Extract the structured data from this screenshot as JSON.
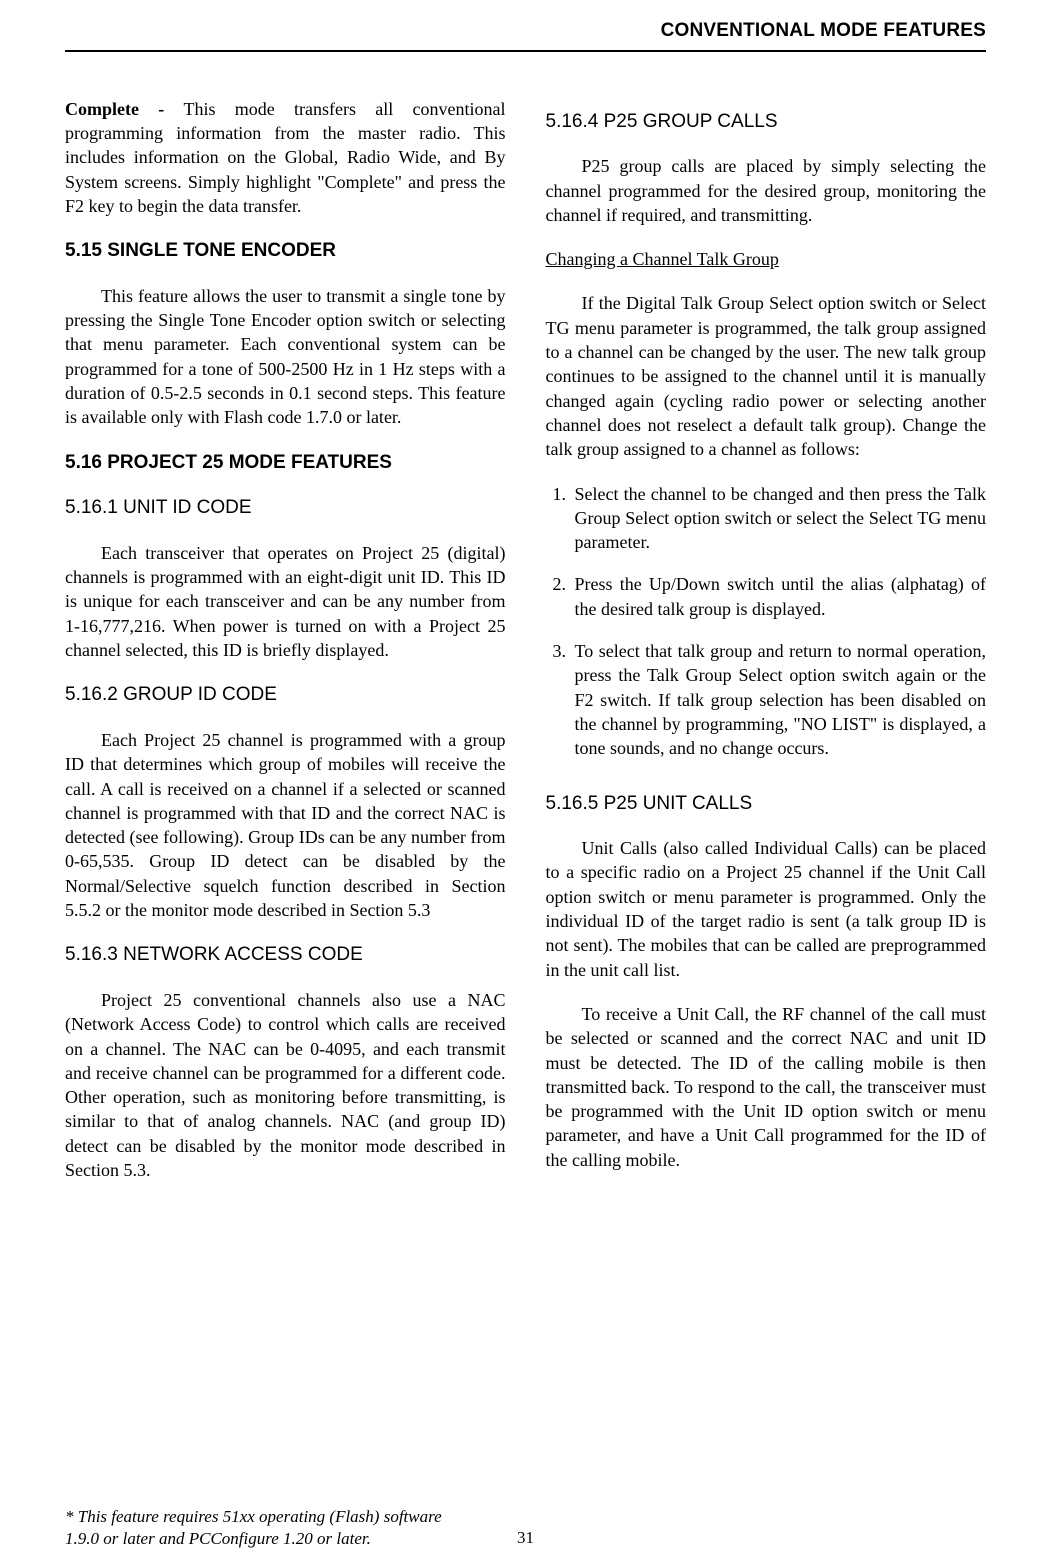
{
  "header": "CONVENTIONAL MODE FEATURES",
  "col1": {
    "p1_bold": "Complete - ",
    "p1_rest": "This mode transfers all conventional programming information from the master radio. This includes information on the Global, Radio Wide, and By System screens. Simply highlight \"Complete\" and press the F2 key to begin the data transfer.",
    "h515": "5.15 SINGLE TONE ENCODER",
    "p515": "This feature allows the user to transmit a single tone by pressing the Single Tone Encoder option switch or selecting that menu parameter. Each conventional system can be programmed for a tone of 500-2500 Hz in 1 Hz steps with a duration of 0.5-2.5 seconds in 0.1 second steps. This feature is available only with Flash code 1.7.0 or later.",
    "h516": "5.16 PROJECT 25 MODE FEATURES",
    "h5161": "5.16.1  UNIT ID CODE",
    "p5161": "Each transceiver that operates on Project 25 (digital) channels is programmed with an eight-digit unit ID. This ID is unique for each transceiver and can be any number from 1-16,777,216. When power is turned on with a Project 25 channel selected, this ID is briefly displayed.",
    "h5162": "5.16.2  GROUP ID CODE",
    "p5162": "Each Project 25 channel is programmed with a group ID that determines which group of mobiles will receive the call. A call is received on a channel if a selected or scanned channel is programmed with that ID and the correct NAC is detected (see following). Group IDs can be any number from 0-65,535. Group ID detect can be disabled by the Normal/Selective squelch function described in Section 5.5.2 or the monitor mode described in Section 5.3",
    "h5163": "5.16.3  NETWORK ACCESS CODE",
    "p5163": "Project 25 conventional channels also use a NAC (Network Access Code) to control which calls are received on a channel. The NAC can be 0-4095, and each transmit and receive channel can be programmed for a different code. Other operation, such as monitoring before transmitting, is similar to that of analog channels. NAC (and group ID) detect can be disabled by the monitor mode described in Section 5.3."
  },
  "col2": {
    "h5164": "5.16.4  P25 GROUP CALLS",
    "p5164": "P25 group calls are placed by simply selecting the channel programmed for the desired group, monitoring the channel if required, and transmitting.",
    "subhead1": "Changing a Channel Talk Group",
    "p_change": "If the Digital Talk Group Select option switch or Select TG menu parameter is programmed, the talk group assigned to a channel can be changed by the user. The new talk group continues to be assigned to the channel until it is manually changed again (cycling radio power or selecting another channel does not reselect a default talk group). Change the talk group assigned to a channel as follows:",
    "list": [
      "Select the channel to be changed and then press the Talk Group Select option switch or select the Select TG menu parameter.",
      "Press the Up/Down switch until the alias (alphatag) of the desired talk group is displayed.",
      "To select that talk group and return to normal operation, press the Talk Group Select option switch again or the F2 switch. If talk group selection has been disabled on the channel by programming, \"NO LIST\" is displayed, a tone sounds, and no change occurs."
    ],
    "h5165": "5.16.5  P25 UNIT CALLS",
    "p5165a": "Unit Calls (also called Individual Calls) can be placed to a specific radio on a Project 25 channel if the Unit Call option switch or menu parameter is programmed. Only the individual ID of the target radio is sent (a talk group ID is not sent). The mobiles that can be called are preprogrammed in the unit call list.",
    "p5165b": "To receive a Unit Call, the RF channel of the call must be selected or scanned and the correct NAC and unit ID must be detected. The ID of the calling mobile is then transmitted back. To respond to the call, the transceiver must be programmed with the Unit ID option switch or menu parameter, and have a Unit Call programmed for the ID of the calling mobile."
  },
  "footnote": "* This feature requires 51xx operating (Flash) software 1.9.0 or later and PCConfigure 1.20 or later.",
  "pagenum": "31"
}
